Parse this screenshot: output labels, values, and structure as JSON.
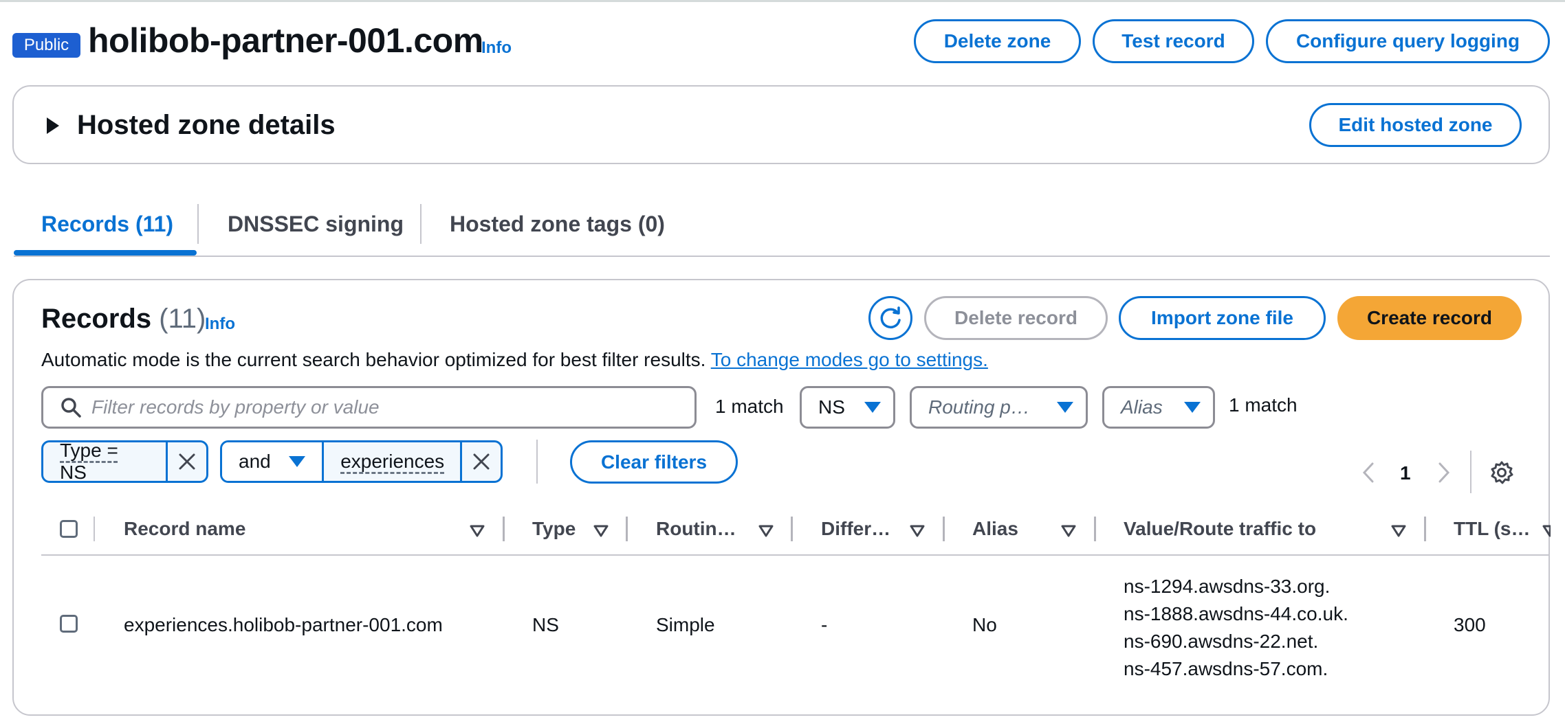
{
  "header": {
    "badge": "Public",
    "zone_name": "holibob-partner-001.com",
    "info": "Info",
    "buttons": {
      "delete_zone": "Delete zone",
      "test_record": "Test record",
      "configure_logging": "Configure query logging"
    }
  },
  "details": {
    "title": "Hosted zone details",
    "edit_button": "Edit hosted zone"
  },
  "tabs": [
    {
      "label": "Records (11)",
      "active": true
    },
    {
      "label": "DNSSEC signing",
      "active": false
    },
    {
      "label": "Hosted zone tags (0)",
      "active": false
    }
  ],
  "records": {
    "title": "Records",
    "count": "(11)",
    "info": "Info",
    "description": "Automatic mode is the current search behavior optimized for best filter results.",
    "settings_link": "To change modes go to settings.",
    "buttons": {
      "delete_record": "Delete record",
      "import_zone": "Import zone file",
      "create_record": "Create record"
    },
    "search_placeholder": "Filter records by property or value",
    "match_text": "1 match",
    "type_select": "NS",
    "routing_select": "Routing p…",
    "alias_select": "Alias",
    "match_text_2": "1 match",
    "filters": {
      "token1": "Type = NS",
      "operator": "and",
      "token2": "experiences",
      "clear_button": "Clear filters"
    },
    "pagination": {
      "page": "1"
    },
    "columns": [
      "Record name",
      "Type",
      "Routin…",
      "Differ…",
      "Alias",
      "Value/Route traffic to",
      "TTL (s…"
    ],
    "rows": [
      {
        "name": "experiences.holibob-partner-001.com",
        "type": "NS",
        "routing": "Simple",
        "differ": "-",
        "alias": "No",
        "values": [
          "ns-1294.awsdns-33.org.",
          "ns-1888.awsdns-44.co.uk.",
          "ns-690.awsdns-22.net.",
          "ns-457.awsdns-57.com."
        ],
        "ttl": "300"
      }
    ]
  },
  "colors": {
    "accent": "#0972d3",
    "primary": "#f4a636",
    "badge": "#1d5fd1"
  }
}
